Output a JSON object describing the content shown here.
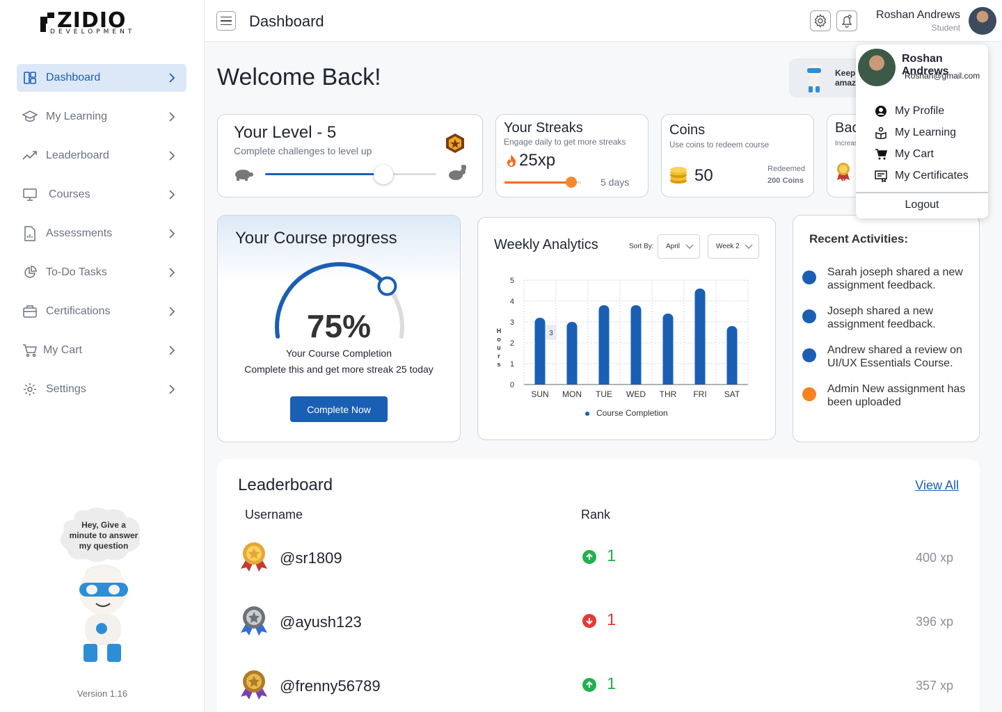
{
  "brand": {
    "name": "ZIDIO",
    "sub": "DEVELOPMENT"
  },
  "sidebar": {
    "items": [
      {
        "label": "Dashboard",
        "icon": "dashboard-icon",
        "active": true
      },
      {
        "label": "My Learning",
        "icon": "graduation-cap-icon"
      },
      {
        "label": "Leaderboard",
        "icon": "trending-up-icon"
      },
      {
        "label": "Courses",
        "icon": "monitor-icon"
      },
      {
        "label": "Assessments",
        "icon": "document-chart-icon"
      },
      {
        "label": "To-Do Tasks",
        "icon": "pie-chart-icon"
      },
      {
        "label": "Certifications",
        "icon": "briefcase-icon"
      },
      {
        "label": "My Cart",
        "icon": "cart-icon"
      },
      {
        "label": "Settings",
        "icon": "gear-icon"
      }
    ],
    "helper_text": "Hey, Give a minute to answer my question",
    "version": "Version 1.16"
  },
  "header": {
    "title": "Dashboard",
    "user_name": "Roshan Andrews",
    "user_role": "Student"
  },
  "main": {
    "welcome": "Welcome Back!",
    "level": {
      "title": "Your Level - 5",
      "subtitle": "Complete challenges to level up",
      "progress": 0.69
    },
    "streaks": {
      "title": "Your Streaks",
      "subtitle": "Engage daily to get more streaks",
      "xp": "25xp",
      "days": "5 days",
      "progress": 0.87
    },
    "coins": {
      "title": "Coins",
      "subtitle": "Use coins to redeem course",
      "value": "50",
      "redeemed_label": "Redeemed",
      "redeemed_value": "200 Coins"
    },
    "badges": {
      "title": "Bac",
      "subtitle": "Increas"
    },
    "keep": {
      "text": "Keep amaz"
    },
    "course_progress": {
      "title": "Your Course progress",
      "percent": "75%",
      "value": 75,
      "label": "Your Course Completion",
      "description": "Complete this and get more streak 25 today",
      "button": "Complete Now"
    },
    "analytics": {
      "title": "Weekly Analytics",
      "sort_label": "Sort By:",
      "month": "April",
      "week": "Week 2",
      "legend": "Course Completion"
    },
    "activities": {
      "title": "Recent Activities:",
      "items": [
        {
          "text": "Sarah joseph shared a new assignment feedback.",
          "color": "#1a5fb4"
        },
        {
          "text": " Joseph shared a new assignment feedback.",
          "color": "#1a5fb4"
        },
        {
          "text": "Andrew shared a review on UI/UX Essentials Course.",
          "color": "#1a5fb4"
        },
        {
          "text": "Admin New assignment has been uploaded",
          "color": "#f5821f"
        }
      ]
    },
    "leaderboard": {
      "title": "Leaderboard",
      "view_all": "View All",
      "col_username": "Username",
      "col_rank": "Rank",
      "rows": [
        {
          "user": "@sr1809",
          "rank": "1",
          "trend": "up",
          "xp": "400 xp",
          "medal": "gold"
        },
        {
          "user": "@ayush123",
          "rank": "1",
          "trend": "down",
          "xp": "396 xp",
          "medal": "silver"
        },
        {
          "user": "@frenny56789",
          "rank": "1",
          "trend": "up",
          "xp": "357 xp",
          "medal": "bronze"
        }
      ]
    }
  },
  "dropdown": {
    "name": "Roshan Andrews",
    "email": "Roshan@gmail.com",
    "items": [
      {
        "label": "My Profile",
        "icon": "profile-icon"
      },
      {
        "label": "My Learning",
        "icon": "reader-icon"
      },
      {
        "label": "My Cart",
        "icon": "cart-icon"
      },
      {
        "label": "My Certificates",
        "icon": "certificate-icon"
      }
    ],
    "logout": "Logout"
  },
  "chart_data": {
    "type": "bar",
    "categories": [
      "SUN",
      "MON",
      "TUE",
      "WED",
      "THR",
      "FRI",
      "SAT"
    ],
    "values": [
      3.2,
      3.0,
      3.8,
      3.8,
      3.4,
      4.6,
      2.8
    ],
    "ylabel": "Hours",
    "ylim": [
      0,
      5
    ],
    "yticks": [
      0,
      1,
      2,
      3,
      4,
      5
    ],
    "annotation": {
      "category": "SUN",
      "text": "3"
    },
    "legend": [
      "Course Completion"
    ],
    "grid": true
  }
}
